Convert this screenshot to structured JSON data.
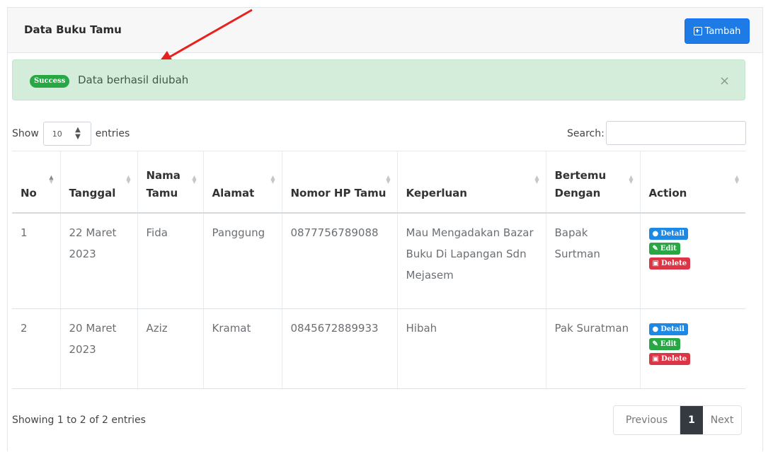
{
  "header": {
    "title": "Data Buku Tamu",
    "add_button_label": "Tambah"
  },
  "alert": {
    "badge": "Success",
    "message": "Data berhasil diubah",
    "close": "×"
  },
  "controls": {
    "show_label": "Show",
    "entries_value": "10",
    "entries_label": "entries",
    "search_label": "Search:"
  },
  "table": {
    "columns": [
      "No",
      "Tanggal",
      "Nama Tamu",
      "Alamat",
      "Nomor HP Tamu",
      "Keperluan",
      "Bertemu Dengan",
      "Action"
    ],
    "rows": [
      {
        "no": "1",
        "tanggal": "22 Maret 2023",
        "nama": "Fida",
        "alamat": "Panggung",
        "hp": "0877756789088",
        "keperluan": "Mau Mengadakan Bazar Buku Di Lapangan Sdn Mejasem",
        "bertemu": "Bapak Surtman"
      },
      {
        "no": "2",
        "tanggal": "20 Maret 2023",
        "nama": "Aziz",
        "alamat": "Kramat",
        "hp": "0845672889933",
        "keperluan": "Hibah",
        "bertemu": "Pak Suratman"
      }
    ],
    "actions": {
      "detail": "Detail",
      "edit": "Edit",
      "delete": "Delete"
    }
  },
  "footer": {
    "info": "Showing 1 to 2 of 2 entries",
    "prev": "Previous",
    "page": "1",
    "next": "Next"
  },
  "colors": {
    "primary": "#1e7be6",
    "success": "#28a745",
    "danger": "#dc3545",
    "alert_bg": "#d4edda",
    "arrow": "#e8201e"
  }
}
